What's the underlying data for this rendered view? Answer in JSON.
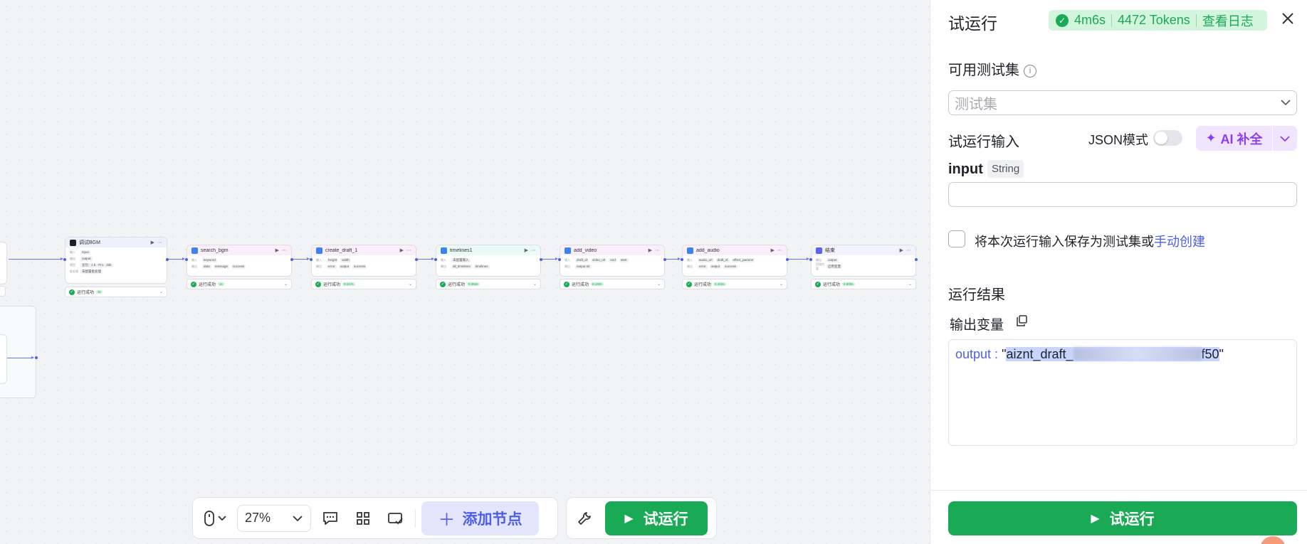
{
  "colors": {
    "accent": "#4f5ee8",
    "success": "#1aaa55",
    "success_bg": "#d3f5de",
    "ai": "#8a3ff0",
    "ai_bg": "#f1e4ff"
  },
  "canvas": {
    "nodes": [
      {
        "title": "调试BGM",
        "rows": [
          [
            "输入",
            [
              "input"
            ]
          ],
          [
            "输出",
            [
              "output"
            ]
          ],
          [
            "模型",
            [
              "豆包 · 1.5 · Pro · 32k"
            ]
          ],
          [
            "批处理",
            [
              "未配置批处理"
            ]
          ]
        ],
        "status": "运行成功",
        "time": "3s",
        "icon": "bot-icon"
      },
      {
        "title": "search_bgm",
        "rows": [
          [
            "输入",
            [
              "keyword"
            ]
          ],
          [
            "输出",
            [
              "data",
              "message",
              "success"
            ]
          ]
        ],
        "status": "运行成功",
        "time": "1s",
        "icon": "plugin-icon"
      },
      {
        "title": "create_draft_1",
        "rows": [
          [
            "输入",
            [
              "height",
              "width"
            ]
          ],
          [
            "输出",
            [
              "error",
              "output",
              "success"
            ]
          ]
        ],
        "status": "运行成功",
        "time": "0.347s",
        "icon": "plugin-icon"
      },
      {
        "title": "timelines1",
        "rows": [
          [
            "输入",
            [
              "未配置输入"
            ]
          ],
          [
            "输出",
            [
              "all_timelines",
              "timelines"
            ]
          ]
        ],
        "status": "运行成功",
        "time": "0.082s",
        "icon": "plugin-icon"
      },
      {
        "title": "add_video",
        "rows": [
          [
            "输入",
            [
              "draft_id",
              "video_url",
              "end",
              "start"
            ]
          ],
          [
            "输出",
            [
              "output.txt"
            ]
          ]
        ],
        "status": "运行成功",
        "time": "0.180s",
        "icon": "plugin-icon"
      },
      {
        "title": "add_audio",
        "rows": [
          [
            "输入",
            [
              "audio_url",
              "draft_id",
              "effect_params"
            ]
          ],
          [
            "输出",
            [
              "error",
              "output",
              "success"
            ]
          ]
        ],
        "status": "运行成功",
        "time": "0.402s",
        "icon": "plugin-icon"
      },
      {
        "title": "结束",
        "rows": [
          [
            "输出",
            [
              "output"
            ]
          ],
          [
            "回答内容",
            [
              "启用变量"
            ]
          ]
        ],
        "status": "运行成功",
        "time": "0.000s",
        "icon": "end-icon"
      }
    ]
  },
  "toolbar": {
    "zoom": "27%",
    "add_node": "添加节点",
    "run": "试运行",
    "icons": [
      "mouse-icon",
      "comment-icon",
      "grid-layout-icon",
      "minimap-icon",
      "wrench-icon"
    ]
  },
  "panel": {
    "title": "试运行",
    "summary": {
      "duration": "4m6s",
      "tokens": "4472 Tokens",
      "log_link": "查看日志"
    },
    "test_set_label": "可用测试集",
    "test_set_placeholder": "测试集",
    "run_input_label": "试运行输入",
    "json_mode_label": "JSON模式",
    "json_mode_on": false,
    "ai_complete_label": "AI 补全",
    "param_name": "input",
    "param_type": "String",
    "param_value": "",
    "save_text": "将本次运行输入保存为测试集或",
    "save_link": "手动创建",
    "result_label": "运行结果",
    "output_vars_label": "输出变量",
    "output_key": "output",
    "output_value_start": "aiznt_draft_",
    "output_value_end": "f50",
    "run_button": "试运行"
  }
}
